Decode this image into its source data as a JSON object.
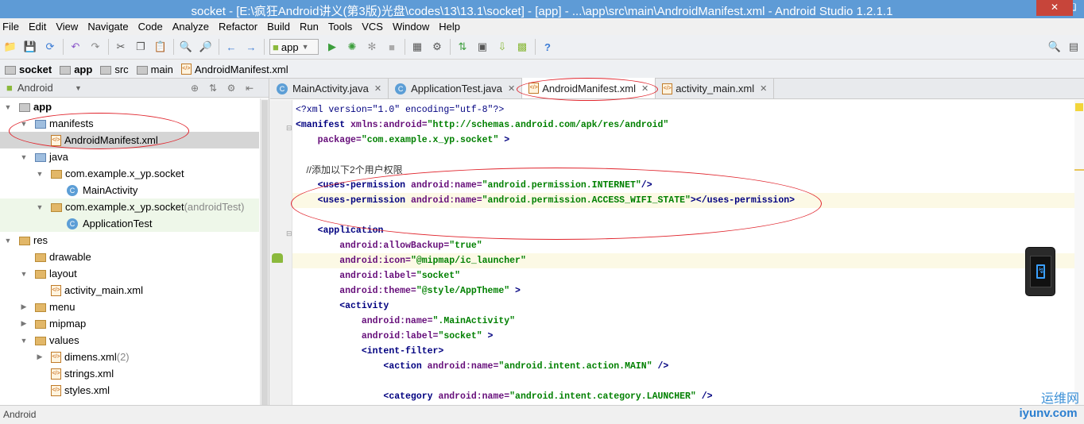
{
  "title": "socket - [E:\\疯狂Android讲义(第3版)光盘\\codes\\13\\13.1\\socket] - [app] - ...\\app\\src\\main\\AndroidManifest.xml - Android Studio 1.2.1.1",
  "menu": [
    "File",
    "Edit",
    "View",
    "Navigate",
    "Code",
    "Analyze",
    "Refactor",
    "Build",
    "Run",
    "Tools",
    "VCS",
    "Window",
    "Help"
  ],
  "toolbar": {
    "run_config": "app"
  },
  "breadcrumbs": [
    "socket",
    "app",
    "src",
    "main",
    "AndroidManifest.xml"
  ],
  "project_view": "Android",
  "tree": [
    {
      "label": "app",
      "suffix": "",
      "level": 0,
      "arrow": "down",
      "icon": "folder-grey",
      "bold": true
    },
    {
      "label": "manifests",
      "suffix": "",
      "level": 1,
      "arrow": "down",
      "icon": "folder-blue"
    },
    {
      "label": "AndroidManifest.xml",
      "suffix": "",
      "level": 2,
      "arrow": "",
      "icon": "xml",
      "selected": true
    },
    {
      "label": "java",
      "suffix": "",
      "level": 1,
      "arrow": "down",
      "icon": "folder-blue"
    },
    {
      "label": "com.example.x_yp.socket",
      "suffix": "",
      "level": 2,
      "arrow": "down",
      "icon": "folder"
    },
    {
      "label": "MainActivity",
      "suffix": "",
      "level": 3,
      "arrow": "",
      "icon": "class"
    },
    {
      "label": "com.example.x_yp.socket",
      "suffix": " (androidTest)",
      "level": 2,
      "arrow": "down",
      "icon": "folder",
      "tinted": true
    },
    {
      "label": "ApplicationTest",
      "suffix": "",
      "level": 3,
      "arrow": "",
      "icon": "class",
      "tinted": true
    },
    {
      "label": "res",
      "suffix": "",
      "level": 0,
      "arrow": "down",
      "icon": "folder"
    },
    {
      "label": "drawable",
      "suffix": "",
      "level": 1,
      "arrow": "",
      "icon": "folder"
    },
    {
      "label": "layout",
      "suffix": "",
      "level": 1,
      "arrow": "down",
      "icon": "folder"
    },
    {
      "label": "activity_main.xml",
      "suffix": "",
      "level": 2,
      "arrow": "",
      "icon": "xml"
    },
    {
      "label": "menu",
      "suffix": "",
      "level": 1,
      "arrow": "right",
      "icon": "folder"
    },
    {
      "label": "mipmap",
      "suffix": "",
      "level": 1,
      "arrow": "right",
      "icon": "folder"
    },
    {
      "label": "values",
      "suffix": "",
      "level": 1,
      "arrow": "down",
      "icon": "folder"
    },
    {
      "label": "dimens.xml",
      "suffix": " (2)",
      "level": 2,
      "arrow": "right",
      "icon": "xml"
    },
    {
      "label": "strings.xml",
      "suffix": "",
      "level": 2,
      "arrow": "",
      "icon": "xml"
    },
    {
      "label": "styles.xml",
      "suffix": "",
      "level": 2,
      "arrow": "",
      "icon": "xml"
    }
  ],
  "tabs": [
    {
      "label": "MainActivity.java",
      "active": false
    },
    {
      "label": "ApplicationTest.java",
      "active": false
    },
    {
      "label": "AndroidManifest.xml",
      "active": true
    },
    {
      "label": "activity_main.xml",
      "active": false
    }
  ],
  "code": [
    [
      [
        "pi",
        "<?xml version=\"1.0\" encoding=\"utf-8\"?>"
      ]
    ],
    [
      [
        "tg",
        "<manifest "
      ],
      [
        "at",
        "xmlns:android="
      ],
      [
        "st",
        "\"http://schemas.android.com/apk/res/android\""
      ]
    ],
    [
      [
        "at",
        "    package="
      ],
      [
        "st",
        "\"com.example.x_yp.socket\""
      ],
      [
        "tg",
        " >"
      ]
    ],
    [],
    [
      [
        "cm",
        "    //添加以下2个用户权限"
      ]
    ],
    [
      [
        "tg",
        "    <uses-permission "
      ],
      [
        "at",
        "android:name="
      ],
      [
        "st",
        "\"android.permission.INTERNET\""
      ],
      [
        "tg",
        "/>"
      ]
    ],
    [
      [
        "tg",
        "    <uses-permission "
      ],
      [
        "at",
        "android:name="
      ],
      [
        "st",
        "\"android.permission.ACCESS_WIFI_STATE\""
      ],
      [
        "tg",
        "></uses-permission>"
      ]
    ],
    [],
    [
      [
        "tg",
        "    <application"
      ]
    ],
    [
      [
        "at",
        "        android:allowBackup="
      ],
      [
        "st",
        "\"true\""
      ]
    ],
    [
      [
        "at",
        "        android:icon="
      ],
      [
        "st",
        "\"@mipmap/ic_launcher\""
      ]
    ],
    [
      [
        "at",
        "        android:label="
      ],
      [
        "st",
        "\"socket\""
      ]
    ],
    [
      [
        "at",
        "        android:theme="
      ],
      [
        "st",
        "\"@style/AppTheme\""
      ],
      [
        "tg",
        " >"
      ]
    ],
    [
      [
        "tg",
        "        <activity"
      ]
    ],
    [
      [
        "at",
        "            android:name="
      ],
      [
        "st",
        "\".MainActivity\""
      ]
    ],
    [
      [
        "at",
        "            android:label="
      ],
      [
        "st",
        "\"socket\""
      ],
      [
        "tg",
        " >"
      ]
    ],
    [
      [
        "tg",
        "            <intent-filter>"
      ]
    ],
    [
      [
        "tg",
        "                <action "
      ],
      [
        "at",
        "android:name="
      ],
      [
        "st",
        "\"android.intent.action.MAIN\""
      ],
      [
        "tg",
        " />"
      ]
    ],
    [],
    [
      [
        "tg",
        "                <category "
      ],
      [
        "at",
        "android:name="
      ],
      [
        "st",
        "\"android.intent.category.LAUNCHER\""
      ],
      [
        "tg",
        " />"
      ]
    ]
  ],
  "status": "Android",
  "watermark": {
    "line1": "运维网",
    "line2": "iyunv.com"
  }
}
